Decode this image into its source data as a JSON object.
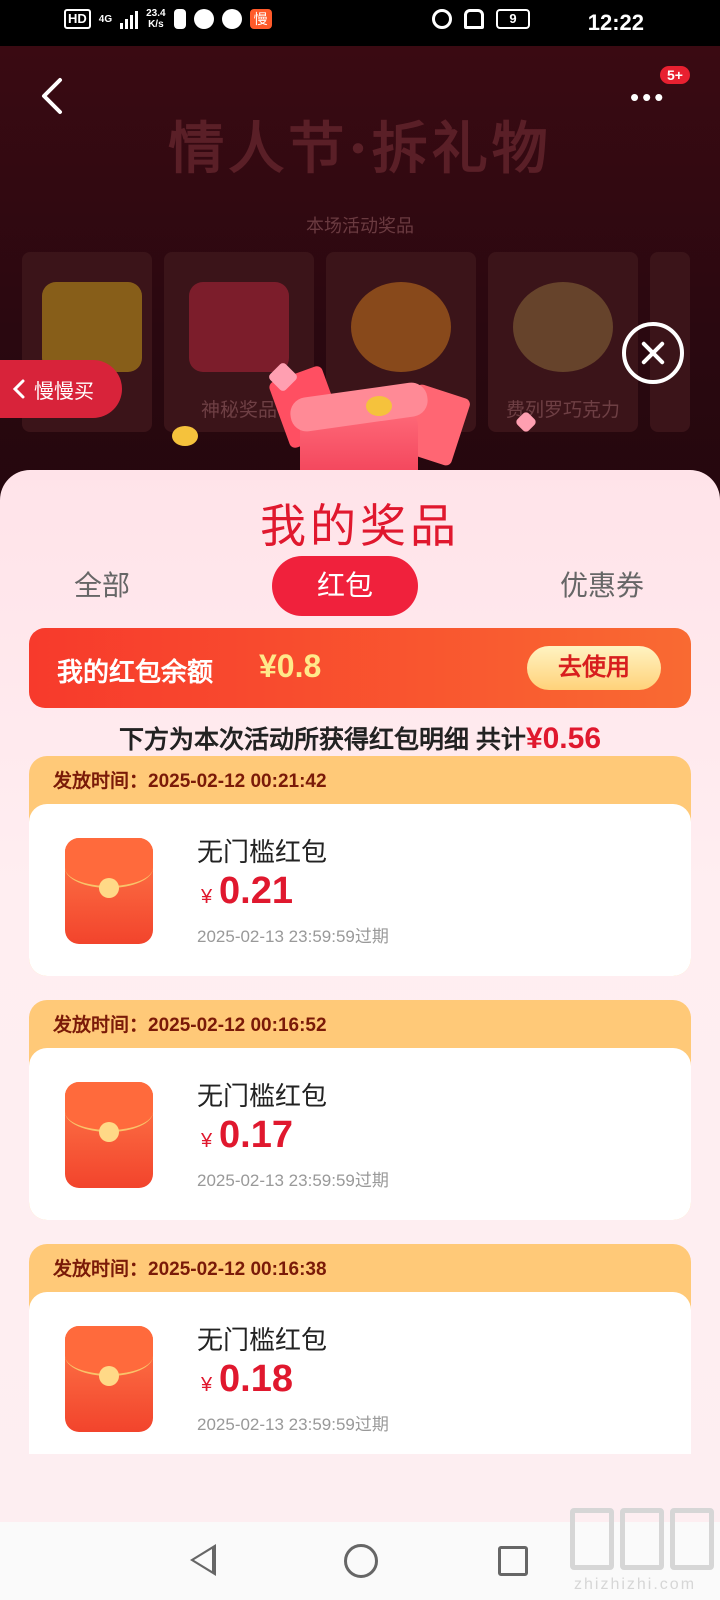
{
  "status_bar": {
    "hd": "HD",
    "net": "4G",
    "speed_value": "23.4",
    "speed_unit": "K/s",
    "app_badge": "慢",
    "battery": "9",
    "time": "12:22"
  },
  "header": {
    "title": "情人节·拆礼物",
    "subtitle": "本场活动奖品",
    "more_badge": "5+",
    "prizes": [
      {
        "label": ""
      },
      {
        "label": "神秘奖品"
      },
      {
        "label": ""
      },
      {
        "label": "费列罗巧克力"
      }
    ]
  },
  "side_button": {
    "label": "慢慢买"
  },
  "sheet": {
    "title": "我的奖品",
    "tabs": [
      "全部",
      "红包",
      "优惠券"
    ],
    "active_tab": "红包",
    "balance_label": "我的红包余额",
    "balance_value": "¥0.8",
    "use_button": "去使用",
    "summary_text": "下方为本次活动所获得红包明细 共计",
    "summary_amount": "¥0.56",
    "records": [
      {
        "issued_label": "发放时间：",
        "issued_time": "2025-02-12 00:21:42",
        "name": "无门槛红包",
        "currency": "¥",
        "amount": "0.21",
        "expiry": "2025-02-13 23:59:59过期"
      },
      {
        "issued_label": "发放时间：",
        "issued_time": "2025-02-12 00:16:52",
        "name": "无门槛红包",
        "currency": "¥",
        "amount": "0.17",
        "expiry": "2025-02-13 23:59:59过期"
      },
      {
        "issued_label": "发放时间：",
        "issued_time": "2025-02-12 00:16:38",
        "name": "无门槛红包",
        "currency": "¥",
        "amount": "0.18",
        "expiry": "2025-02-13 23:59:59过期"
      }
    ]
  },
  "watermark": {
    "text": "zhizhizhi.com"
  },
  "colors": {
    "accent": "#e0182e",
    "tab_active": "#f0213c",
    "balance_bg": "#f9562f",
    "record_head": "#ffc978"
  }
}
